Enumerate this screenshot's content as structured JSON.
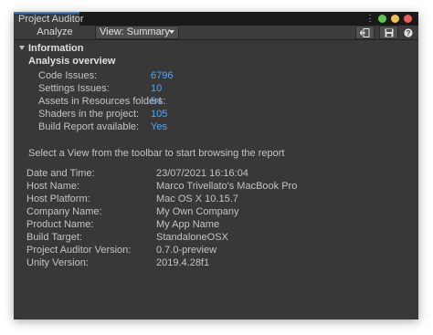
{
  "window": {
    "tab_title": "Project Auditor",
    "colors": {
      "close": "#ec5f57",
      "minimize": "#f5bd4f",
      "maximize": "#5fc64f",
      "accent": "#3a79bb",
      "link": "#5aa5f0"
    }
  },
  "toolbar": {
    "analyze_label": "Analyze",
    "view_dropdown_value": "View: Summary",
    "icons": [
      "export-icon",
      "save-icon",
      "help-icon"
    ]
  },
  "information": {
    "foldout_label": "Information",
    "analysis_header": "Analysis overview",
    "stats": [
      {
        "label": "Code Issues:",
        "value": "6796"
      },
      {
        "label": "Settings Issues:",
        "value": "10"
      },
      {
        "label": "Assets in Resources folders:",
        "value": "54"
      },
      {
        "label": "Shaders in the project:",
        "value": "105"
      },
      {
        "label": "Build Report available:",
        "value": "Yes"
      }
    ],
    "hint": "Select a View from the toolbar to start browsing the report",
    "details": [
      {
        "label": "Date and Time:",
        "value": "23/07/2021 16:16:04"
      },
      {
        "label": "Host Name:",
        "value": "Marco Trivellato's MacBook Pro"
      },
      {
        "label": "Host Platform:",
        "value": "Mac OS X 10.15.7"
      },
      {
        "label": "Company Name:",
        "value": "My Own Company"
      },
      {
        "label": "Product Name:",
        "value": "My App Name"
      },
      {
        "label": "Build Target:",
        "value": "StandaloneOSX"
      },
      {
        "label": "Project Auditor Version:",
        "value": "0.7.0-preview"
      },
      {
        "label": "Unity Version:",
        "value": "2019.4.28f1"
      }
    ]
  }
}
